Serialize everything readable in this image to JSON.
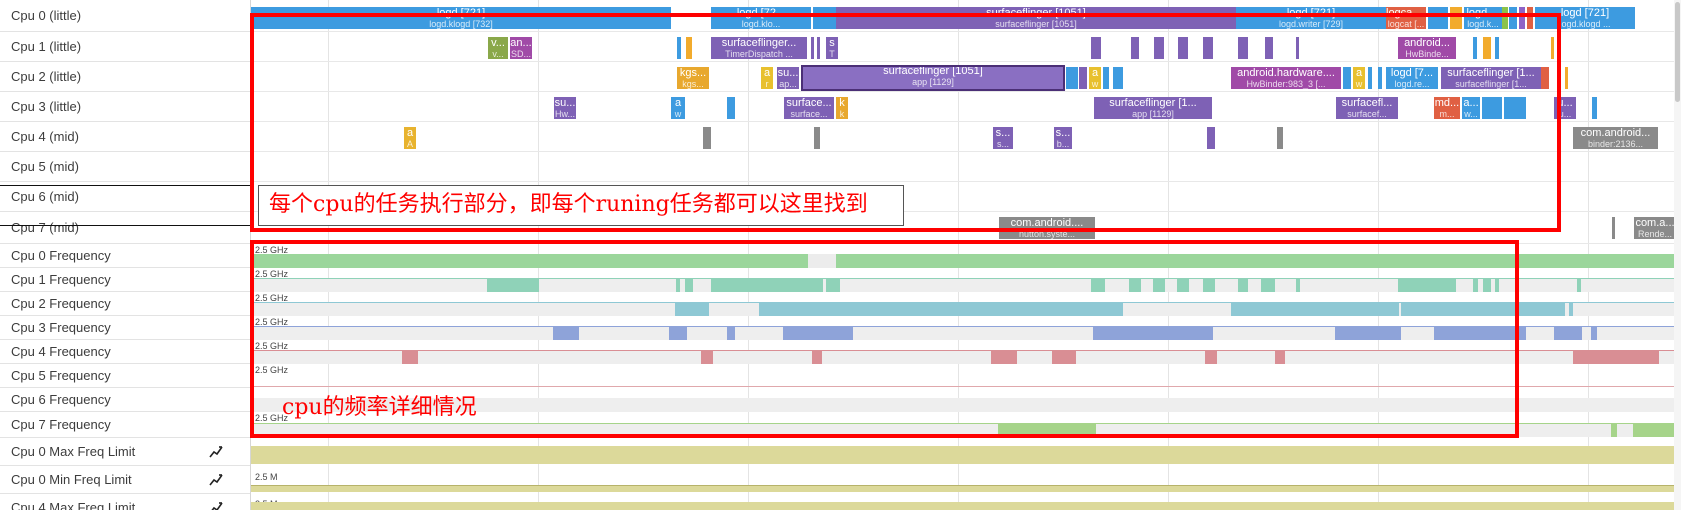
{
  "rows": {
    "cpu0": "Cpu 0 (little)",
    "cpu1": "Cpu 1 (little)",
    "cpu2": "Cpu 2 (little)",
    "cpu3": "Cpu 3 (little)",
    "cpu4": "Cpu 4 (mid)",
    "cpu5": "Cpu 5 (mid)",
    "cpu6": "Cpu 6 (mid)",
    "cpu7": "Cpu 7 (mid)",
    "freq0": "Cpu 0 Frequency",
    "freq1": "Cpu 1 Frequency",
    "freq2": "Cpu 2 Frequency",
    "freq3": "Cpu 3 Frequency",
    "freq4": "Cpu 4 Frequency",
    "freq5": "Cpu 5 Frequency",
    "freq6": "Cpu 6 Frequency",
    "freq7": "Cpu 7 Frequency",
    "max0": "Cpu 0 Max Freq Limit",
    "min0": "Cpu 0 Min Freq Limit",
    "max4": "Cpu 4 Max Freq Limit"
  },
  "freq_scale_label": "2.5 GHz",
  "limit_scale_label": "2.5 M",
  "slices": {
    "cpu0": [
      {
        "title": "logd [721]",
        "sub": "logd.klogd [732]"
      },
      {
        "title": "logd [72...",
        "sub": "logd.klo..."
      },
      {
        "title": "surfaceflinger [1051]",
        "sub": "surfaceflinger [1051]"
      },
      {
        "title": "logd [721]",
        "sub": "logd.writer [729]"
      },
      {
        "title": "logcat [...",
        "sub": "logcat [..."
      },
      {
        "title": "logd ...",
        "sub": "logd.k..."
      },
      {
        "title": "logd [721]",
        "sub": "logd.klogd ..."
      }
    ],
    "cpu1": [
      {
        "title": "v...",
        "sub": "v..."
      },
      {
        "title": "an...",
        "sub": "SD..."
      },
      {
        "title": "surfaceflinger...",
        "sub": "TimerDispatch ..."
      },
      {
        "title": "s",
        "sub": "T"
      },
      {
        "title": "android...",
        "sub": "HwBinde..."
      }
    ],
    "cpu2": [
      {
        "title": "kgs...",
        "sub": "kgs..."
      },
      {
        "title": "a",
        "sub": "r"
      },
      {
        "title": "su...",
        "sub": "ap..."
      },
      {
        "title": "surfaceflinger [1051]",
        "sub": "app [1129]"
      },
      {
        "title": "a",
        "sub": "w"
      },
      {
        "title": "android.hardware....",
        "sub": "HwBinder:983_3 [..."
      },
      {
        "title": "a",
        "sub": "w"
      },
      {
        "title": "logd [7...",
        "sub": "logd.re..."
      },
      {
        "title": "surfaceflinger [1...",
        "sub": "surfaceflinger [1..."
      }
    ],
    "cpu3": [
      {
        "title": "su...",
        "sub": "Hw..."
      },
      {
        "title": "a",
        "sub": "w"
      },
      {
        "title": "surface...",
        "sub": "surface..."
      },
      {
        "title": "k",
        "sub": "k"
      },
      {
        "title": "surfaceflinger [1...",
        "sub": "app [1129]"
      },
      {
        "title": "surfacefl...",
        "sub": "surfacef..."
      },
      {
        "title": "md...",
        "sub": "m..."
      },
      {
        "title": "a...",
        "sub": "w..."
      },
      {
        "title": "u...",
        "sub": "u..."
      }
    ],
    "cpu4": [
      {
        "title": "a",
        "sub": "A"
      },
      {
        "title": "s...",
        "sub": "s..."
      },
      {
        "title": "s...",
        "sub": "b..."
      },
      {
        "title": "com.android...",
        "sub": "binder:2136..."
      }
    ],
    "cpu7": [
      {
        "title": "com.android....",
        "sub": "nutton.syste..."
      },
      {
        "title": "com.a...",
        "sub": "Rende..."
      }
    ]
  },
  "annotations": {
    "cpu_note": "每个cpu的任务执行部分，即每个runing任务都可以这里找到",
    "freq_note": "cpu的频率详细情况"
  },
  "colors": {
    "annotation": "#ff0000",
    "freq0": "#9bd69b",
    "freq1": "#8fd2b8",
    "freq2": "#8ec8d4",
    "freq3": "#8ea3d9",
    "freq4": "#d98e94",
    "freq7": "#a6d48a",
    "limit": "#dcd99a"
  }
}
